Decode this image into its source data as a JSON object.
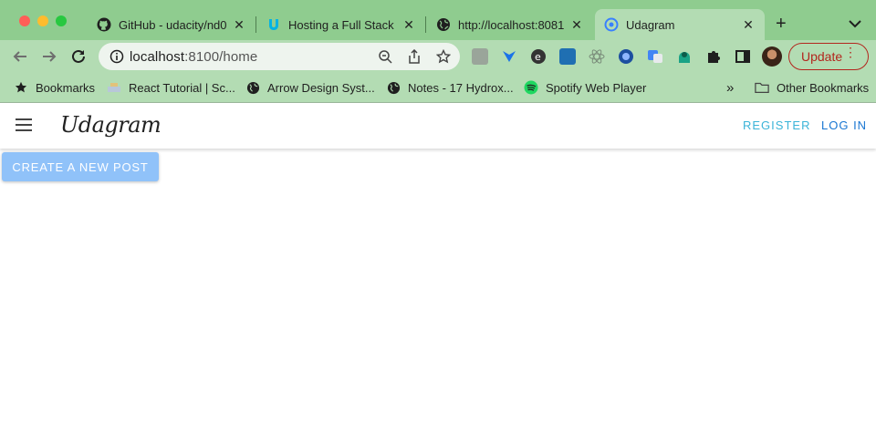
{
  "browser": {
    "tabs": [
      {
        "title": "GitHub - udacity/nd0",
        "icon": "github-icon"
      },
      {
        "title": "Hosting a Full Stack A",
        "icon": "udacity-icon"
      },
      {
        "title": "http://localhost:8081/",
        "icon": "globe-icon"
      },
      {
        "title": "Udagram",
        "icon": "ionic-icon",
        "active": true
      }
    ],
    "address": {
      "host": "localhost",
      "path": ":8100/home"
    },
    "update_label": "Update",
    "bookmarks": [
      {
        "label": "Bookmarks",
        "icon": "star-icon"
      },
      {
        "label": "React Tutorial | Sc...",
        "icon": "react-tutorial-icon"
      },
      {
        "label": "Arrow Design Syst...",
        "icon": "globe-icon"
      },
      {
        "label": "Notes - 17 Hydrox...",
        "icon": "globe-icon"
      },
      {
        "label": "Spotify Web Player",
        "icon": "spotify-icon"
      }
    ],
    "overflow_label": "»",
    "other_bookmarks": "Other Bookmarks"
  },
  "app": {
    "brand": "Udagram",
    "register": "REGISTER",
    "login": "LOG IN",
    "create_post": "CREATE A NEW POST"
  },
  "colors": {
    "chrome_frame": "#8fcc8f",
    "chrome_toolbar": "#b3dcb3",
    "register": "#3bb4d8",
    "login": "#1976d2",
    "create_button": "#90c2f9",
    "update": "#b3261e"
  }
}
